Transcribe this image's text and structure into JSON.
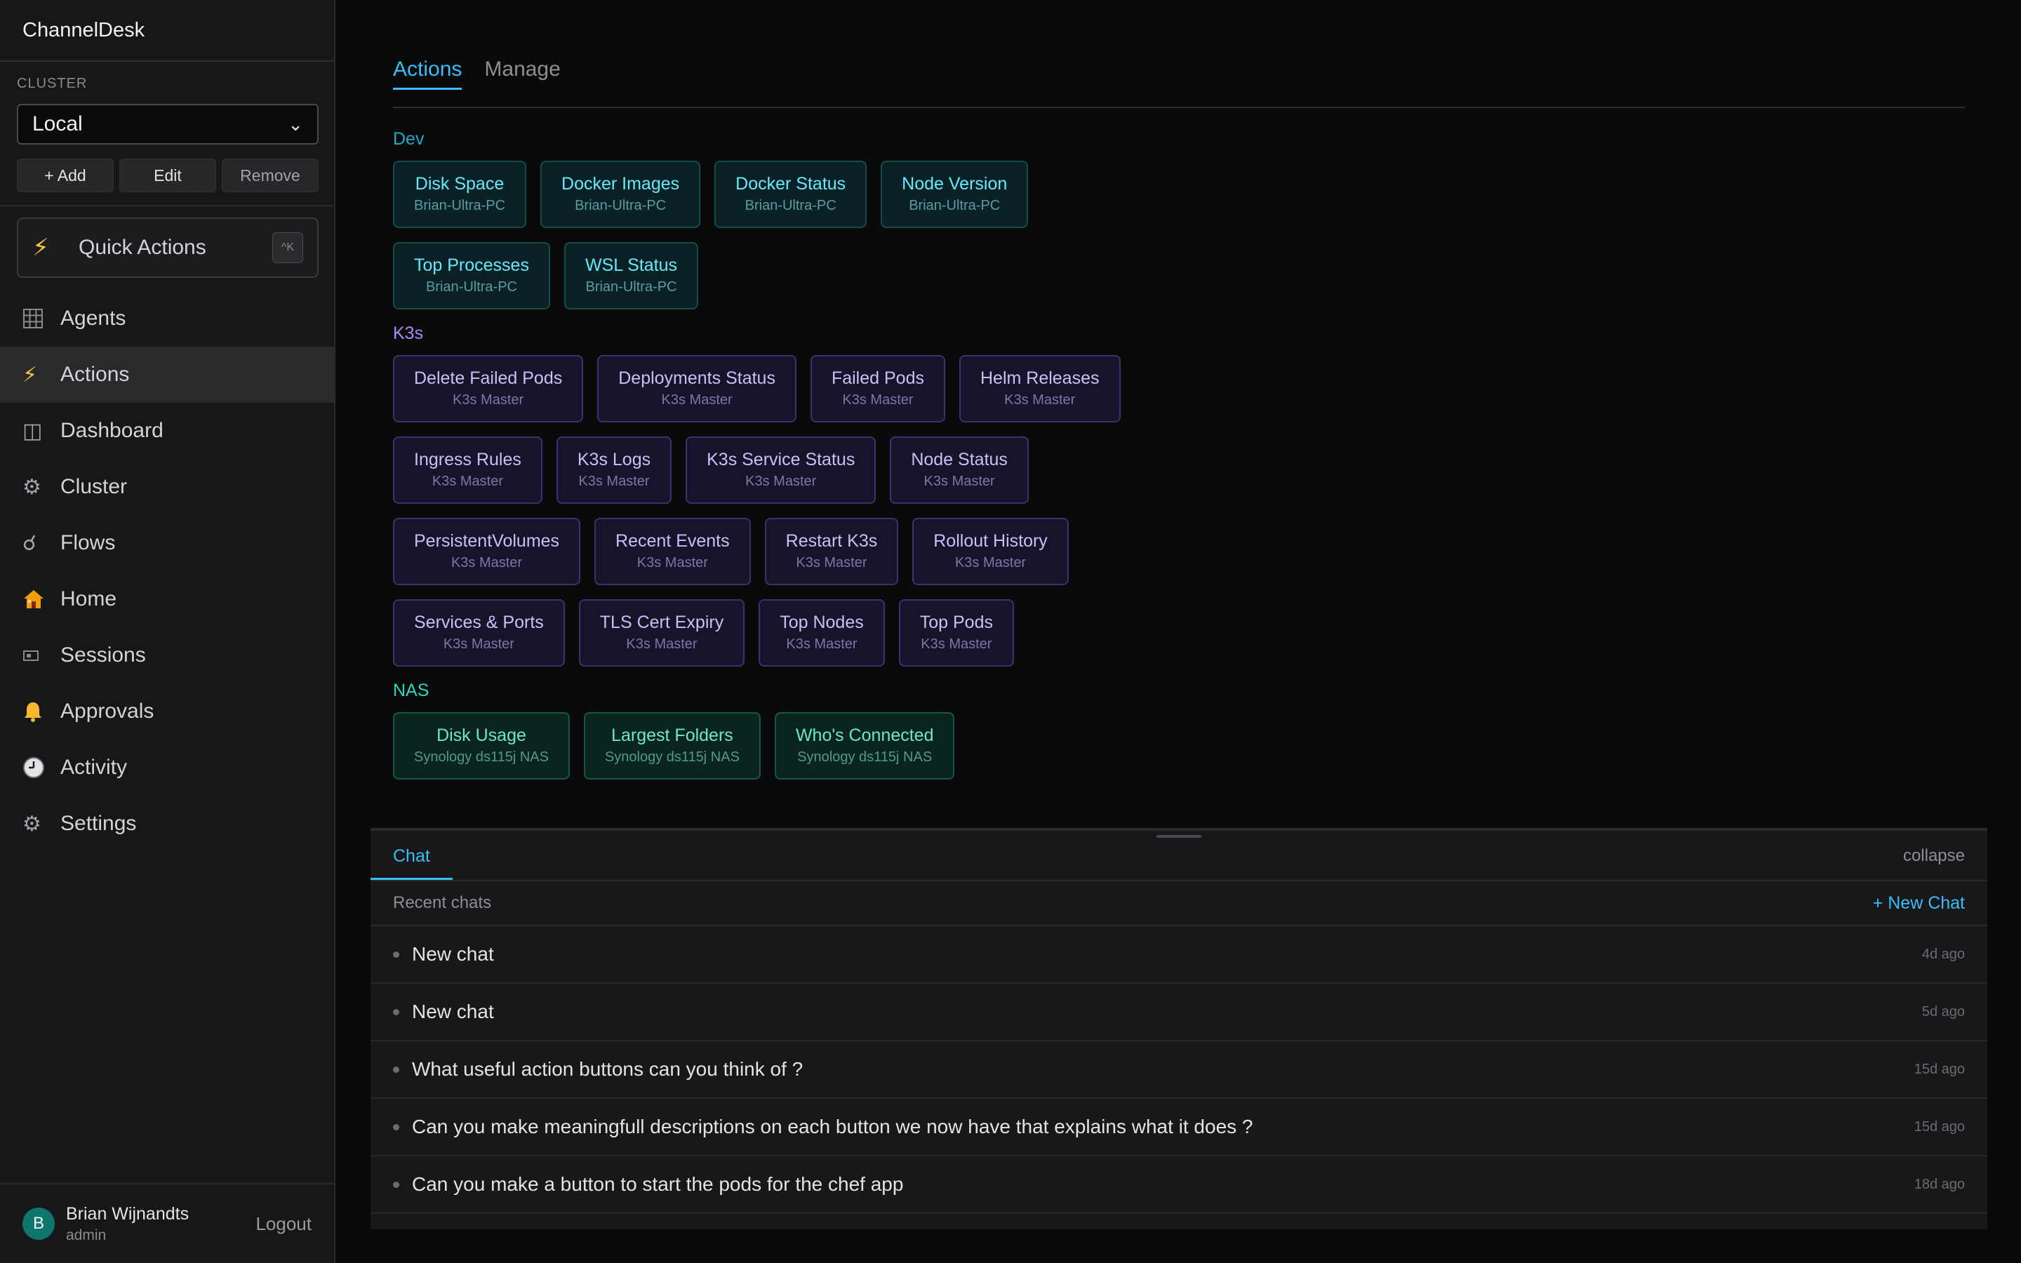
{
  "app": {
    "title": "ChannelDesk"
  },
  "sidebar": {
    "cluster_label": "CLUSTER",
    "cluster_value": "Local",
    "buttons": {
      "add": "+ Add",
      "edit": "Edit",
      "remove": "Remove"
    },
    "quick_actions": {
      "label": "Quick Actions",
      "shortcut": "^K"
    },
    "nav": [
      {
        "label": "Agents",
        "icon": "grid-icon"
      },
      {
        "label": "Actions",
        "icon": "lightning-icon",
        "active": true
      },
      {
        "label": "Dashboard",
        "icon": "dashboard-icon"
      },
      {
        "label": "Cluster",
        "icon": "gear-icon"
      },
      {
        "label": "Flows",
        "icon": "flow-icon"
      },
      {
        "label": "Home",
        "icon": "house-icon"
      },
      {
        "label": "Sessions",
        "icon": "sessions-icon"
      },
      {
        "label": "Approvals",
        "icon": "bell-icon"
      },
      {
        "label": "Activity",
        "icon": "clock-icon"
      },
      {
        "label": "Settings",
        "icon": "gear-icon"
      }
    ],
    "user": {
      "initial": "B",
      "name": "Brian Wijnandts",
      "role": "admin",
      "logout": "Logout"
    }
  },
  "main": {
    "tabs": [
      {
        "label": "Actions",
        "active": true
      },
      {
        "label": "Manage",
        "active": false
      }
    ],
    "groups": [
      {
        "name": "Dev",
        "color": "#22a8c7",
        "buttons": [
          {
            "title": "Disk Space",
            "sub": "Brian-Ultra-PC"
          },
          {
            "title": "Docker Images",
            "sub": "Brian-Ultra-PC"
          },
          {
            "title": "Docker Status",
            "sub": "Brian-Ultra-PC"
          },
          {
            "title": "Node Version",
            "sub": "Brian-Ultra-PC"
          },
          {
            "title": "Top Processes",
            "sub": "Brian-Ultra-PC"
          },
          {
            "title": "WSL Status",
            "sub": "Brian-Ultra-PC"
          }
        ]
      },
      {
        "name": "K3s",
        "color": "#a78bfa",
        "buttons": [
          {
            "title": "Delete Failed Pods",
            "sub": "K3s Master"
          },
          {
            "title": "Deployments Status",
            "sub": "K3s Master"
          },
          {
            "title": "Failed Pods",
            "sub": "K3s Master"
          },
          {
            "title": "Helm Releases",
            "sub": "K3s Master"
          },
          {
            "title": "Ingress Rules",
            "sub": "K3s Master"
          },
          {
            "title": "K3s Logs",
            "sub": "K3s Master"
          },
          {
            "title": "K3s Service Status",
            "sub": "K3s Master"
          },
          {
            "title": "Node Status",
            "sub": "K3s Master"
          },
          {
            "title": "PersistentVolumes",
            "sub": "K3s Master"
          },
          {
            "title": "Recent Events",
            "sub": "K3s Master"
          },
          {
            "title": "Restart K3s",
            "sub": "K3s Master"
          },
          {
            "title": "Rollout History",
            "sub": "K3s Master"
          },
          {
            "title": "Services & Ports",
            "sub": "K3s Master"
          },
          {
            "title": "TLS Cert Expiry",
            "sub": "K3s Master"
          },
          {
            "title": "Top Nodes",
            "sub": "K3s Master"
          },
          {
            "title": "Top Pods",
            "sub": "K3s Master"
          }
        ]
      },
      {
        "name": "NAS",
        "color": "#2dd4bf",
        "buttons": [
          {
            "title": "Disk Usage",
            "sub": "Synology ds115j NAS"
          },
          {
            "title": "Largest Folders",
            "sub": "Synology ds115j NAS"
          },
          {
            "title": "Who's Connected",
            "sub": "Synology ds115j NAS"
          }
        ]
      }
    ]
  },
  "chat": {
    "tab": "Chat",
    "collapse": "collapse",
    "recent_label": "Recent chats",
    "new_chat": "+ New Chat",
    "items": [
      {
        "title": "New chat",
        "time": "4d ago"
      },
      {
        "title": "New chat",
        "time": "5d ago"
      },
      {
        "title": "What useful action buttons can you think of ?",
        "time": "15d ago"
      },
      {
        "title": "Can you make meaningfull descriptions on each button we now have that explains what it does ?",
        "time": "15d ago"
      },
      {
        "title": "Can you make a button to start the pods for the chef app",
        "time": "18d ago"
      }
    ]
  }
}
